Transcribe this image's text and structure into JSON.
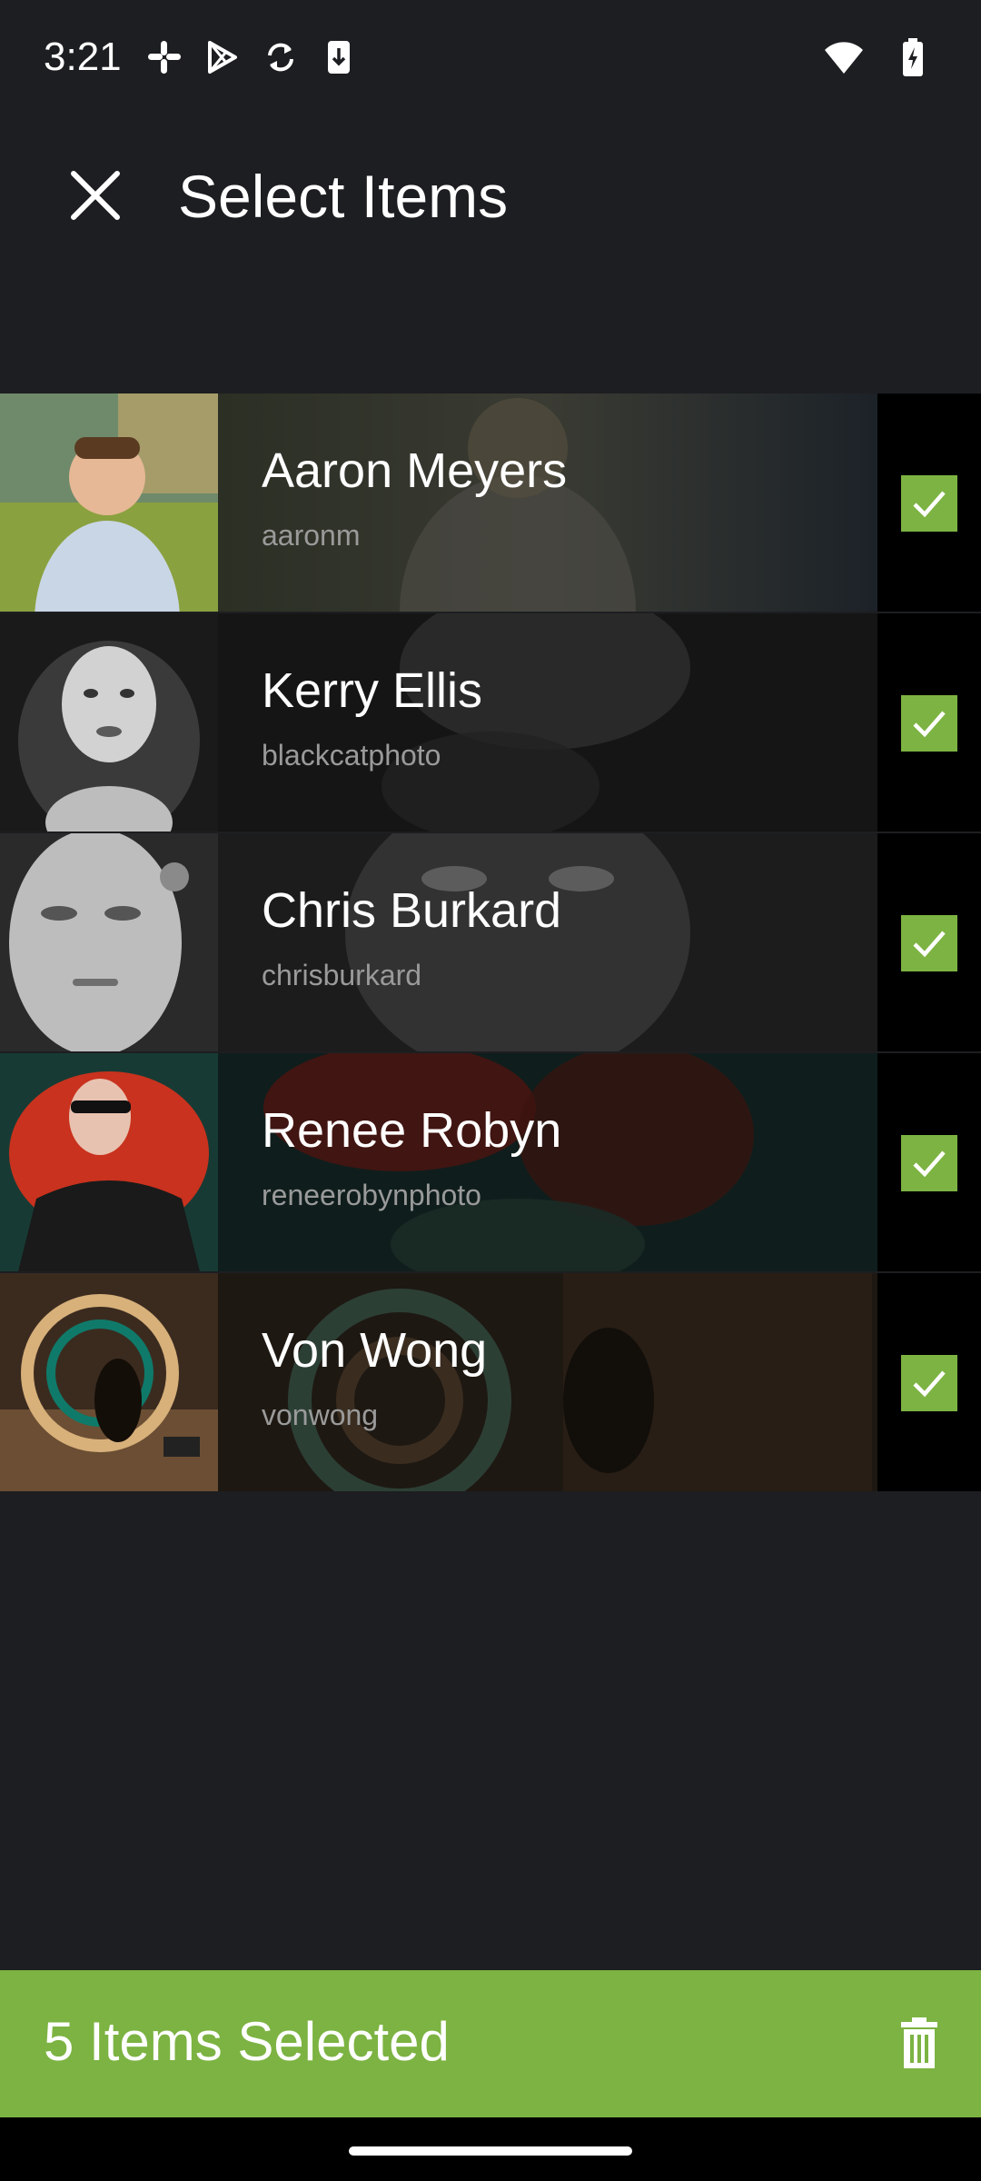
{
  "status_bar": {
    "time": "3:21",
    "left_icons": [
      "slack-icon",
      "play-store-icon",
      "sync-icon",
      "download-icon"
    ],
    "right_icons": [
      "wifi-icon",
      "battery-charging-icon"
    ]
  },
  "app_bar": {
    "title": "Select Items",
    "close_icon": "close-icon"
  },
  "items": [
    {
      "name": "Aaron Meyers",
      "username": "aaronm",
      "checked": true,
      "thumb_colors": [
        "#8aa13f",
        "#f0d3b1",
        "#6c8fb3"
      ]
    },
    {
      "name": "Kerry Ellis",
      "username": "blackcatphoto",
      "checked": true,
      "thumb_colors": [
        "#1a1a1a",
        "#c9c9c9",
        "#5a5a5a"
      ]
    },
    {
      "name": "Chris Burkard",
      "username": "chrisburkard",
      "checked": true,
      "thumb_colors": [
        "#2a2a2a",
        "#bdbdbd",
        "#6e6e6e"
      ]
    },
    {
      "name": "Renee Robyn",
      "username": "reneerobynphoto",
      "checked": true,
      "thumb_colors": [
        "#173b34",
        "#c9321e",
        "#e8c2b0"
      ]
    },
    {
      "name": "Von Wong",
      "username": "vonwong",
      "checked": true,
      "thumb_colors": [
        "#3b2b1f",
        "#d7b07a",
        "#0f7a6a"
      ]
    }
  ],
  "bottom_bar": {
    "selected_label": "5 Items Selected",
    "trash_icon": "trash-icon",
    "color": "#7cb342"
  }
}
